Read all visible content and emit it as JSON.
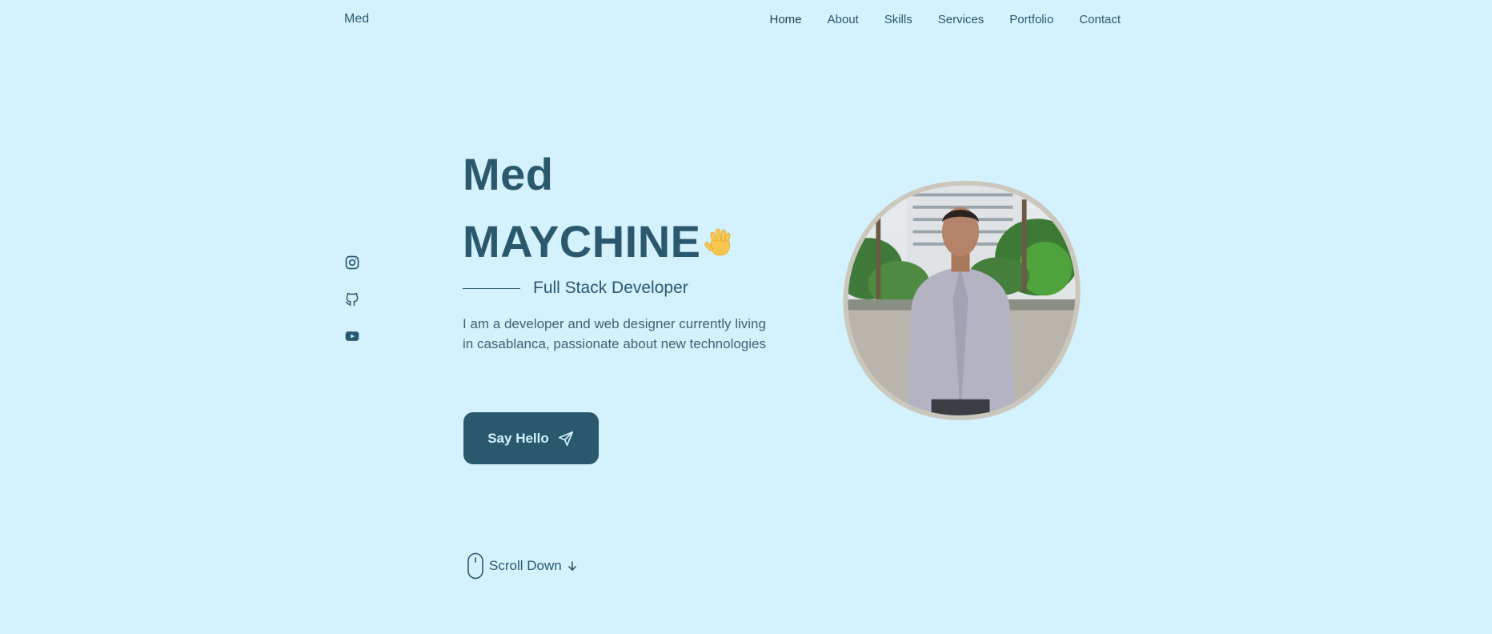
{
  "header": {
    "logo": "Med",
    "nav": [
      {
        "label": "Home"
      },
      {
        "label": "About"
      },
      {
        "label": "Skills"
      },
      {
        "label": "Services"
      },
      {
        "label": "Portfolio"
      },
      {
        "label": "Contact"
      }
    ]
  },
  "social": [
    {
      "icon": "instagram-icon"
    },
    {
      "icon": "github-icon"
    },
    {
      "icon": "youtube-icon"
    }
  ],
  "hero": {
    "first_name": "Med",
    "last_name": "MAYCHINE",
    "subtitle": "Full Stack Developer",
    "description": "I am a developer and web designer currently living in casablanca, passionate about new technologies",
    "cta_label": "Say Hello",
    "scroll_label": "Scroll Down"
  },
  "colors": {
    "background": "#d4f2fd",
    "primary": "#2a586d",
    "button_text": "#d4f2fd"
  },
  "icons": {
    "wave": "waving-hand-icon",
    "cta": "paper-plane-icon",
    "mouse": "mouse-icon",
    "arrow": "arrow-down-icon"
  }
}
